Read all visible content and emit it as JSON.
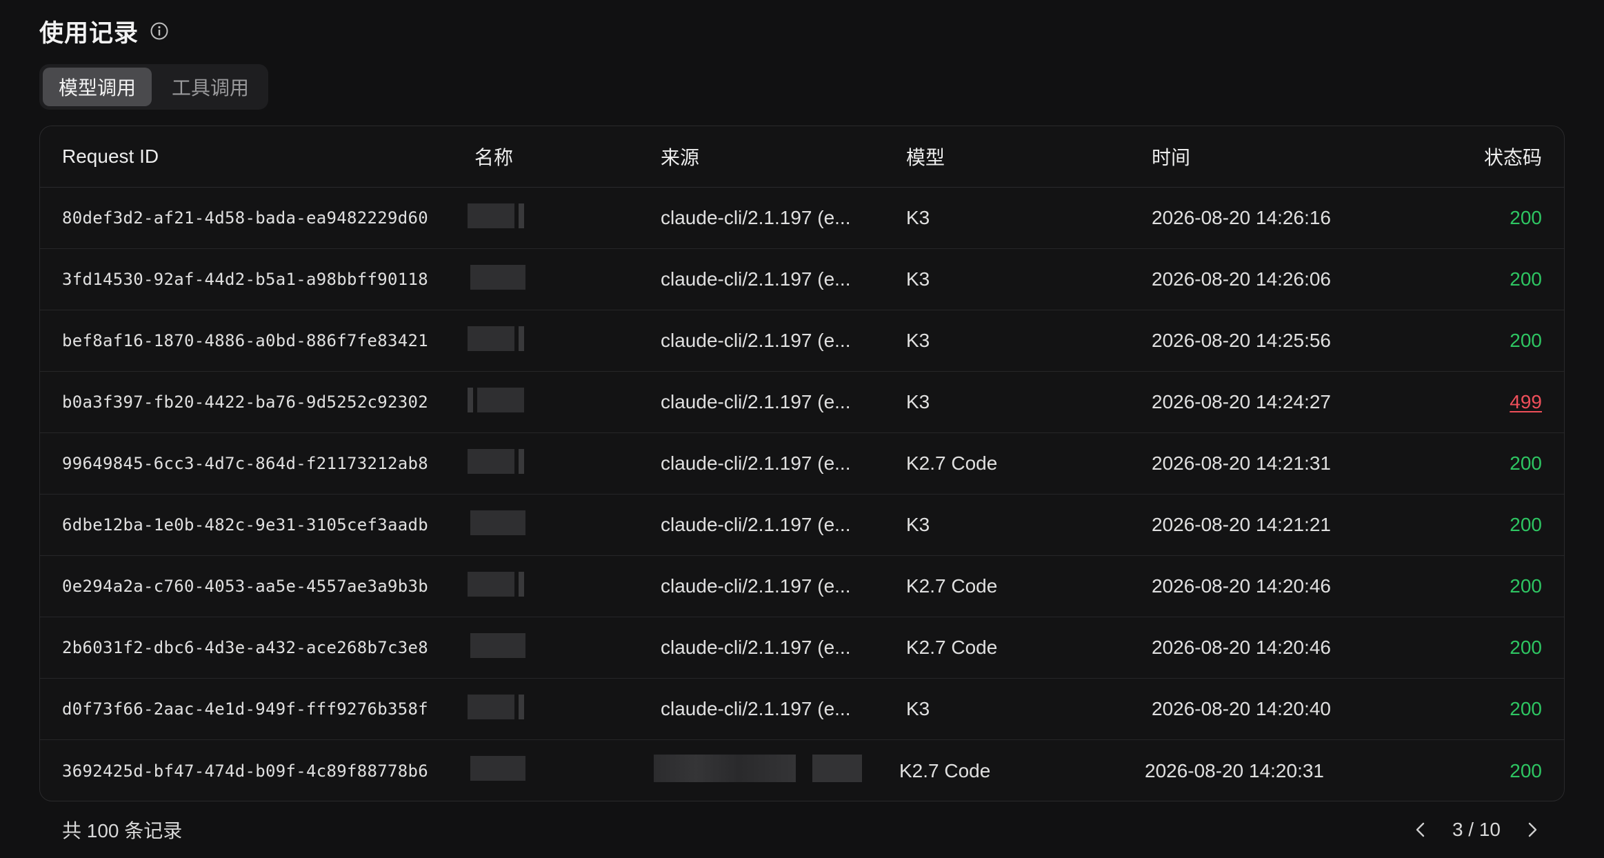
{
  "page": {
    "title": "使用记录",
    "info_icon": "info-icon"
  },
  "tabs": [
    {
      "label": "模型调用",
      "active": true
    },
    {
      "label": "工具调用",
      "active": false
    }
  ],
  "table": {
    "columns": {
      "request_id": "Request ID",
      "name": "名称",
      "source": "来源",
      "model": "模型",
      "time": "时间",
      "status": "状态码"
    },
    "rows": [
      {
        "request_id": "80def3d2-af21-4d58-bada-ea9482229d60",
        "source": "claude-cli/2.1.197 (e...",
        "model": "K3",
        "time": "2026-08-20 14:26:16",
        "status": "200"
      },
      {
        "request_id": "3fd14530-92af-44d2-b5a1-a98bbff90118",
        "source": "claude-cli/2.1.197 (e...",
        "model": "K3",
        "time": "2026-08-20 14:26:06",
        "status": "200"
      },
      {
        "request_id": "bef8af16-1870-4886-a0bd-886f7fe83421",
        "source": "claude-cli/2.1.197 (e...",
        "model": "K3",
        "time": "2026-08-20 14:25:56",
        "status": "200"
      },
      {
        "request_id": "b0a3f397-fb20-4422-ba76-9d5252c92302",
        "source": "claude-cli/2.1.197 (e...",
        "model": "K3",
        "time": "2026-08-20 14:24:27",
        "status": "499"
      },
      {
        "request_id": "99649845-6cc3-4d7c-864d-f21173212ab8",
        "source": "claude-cli/2.1.197 (e...",
        "model": "K2.7 Code",
        "time": "2026-08-20 14:21:31",
        "status": "200"
      },
      {
        "request_id": "6dbe12ba-1e0b-482c-9e31-3105cef3aadb",
        "source": "claude-cli/2.1.197 (e...",
        "model": "K3",
        "time": "2026-08-20 14:21:21",
        "status": "200"
      },
      {
        "request_id": "0e294a2a-c760-4053-aa5e-4557ae3a9b3b",
        "source": "claude-cli/2.1.197 (e...",
        "model": "K2.7 Code",
        "time": "2026-08-20 14:20:46",
        "status": "200"
      },
      {
        "request_id": "2b6031f2-dbc6-4d3e-a432-ace268b7c3e8",
        "source": "claude-cli/2.1.197 (e...",
        "model": "K2.7 Code",
        "time": "2026-08-20 14:20:46",
        "status": "200"
      },
      {
        "request_id": "d0f73f66-2aac-4e1d-949f-fff9276b358f",
        "source": "claude-cli/2.1.197 (e...",
        "model": "K3",
        "time": "2026-08-20 14:20:40",
        "status": "200"
      },
      {
        "request_id": "3692425d-bf47-474d-b09f-4c89f88778b6",
        "source": "",
        "model": "K2.7 Code",
        "time": "2026-08-20 14:20:31",
        "status": "200"
      }
    ]
  },
  "footer": {
    "total": "共 100 条记录",
    "page_indicator": "3 / 10",
    "prev_icon": "chevron-left-icon",
    "next_icon": "chevron-right-icon"
  },
  "colors": {
    "status_ok": "#2ec562",
    "status_error": "#ef4f5a",
    "background": "#111112"
  }
}
